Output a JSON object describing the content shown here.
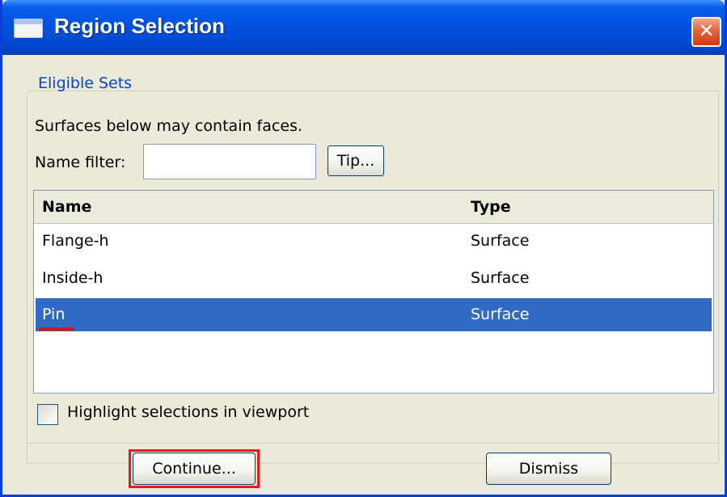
{
  "window": {
    "title": "Region Selection",
    "close_symbol": "✕",
    "title_icon": "window-icon",
    "close_icon": "close-icon"
  },
  "section": {
    "title": "Eligible Sets",
    "description": "Surfaces below may contain faces."
  },
  "filter": {
    "label": "Name filter:",
    "value": "",
    "tip_label": "Tip..."
  },
  "table": {
    "columns": [
      "Name",
      "Type"
    ],
    "rows": [
      {
        "name": "Flange-h",
        "type": "Surface",
        "selected": false
      },
      {
        "name": "Inside-h",
        "type": "Surface",
        "selected": false
      },
      {
        "name": "Pin",
        "type": "Surface",
        "selected": true
      }
    ]
  },
  "highlight": {
    "label": "Highlight selections in viewport",
    "checked": false
  },
  "buttons": {
    "continue": "Continue...",
    "dismiss": "Dismiss"
  },
  "colors": {
    "title_bar": "#0054e3",
    "selection": "#316ac5",
    "annotation": "#e8181e"
  }
}
